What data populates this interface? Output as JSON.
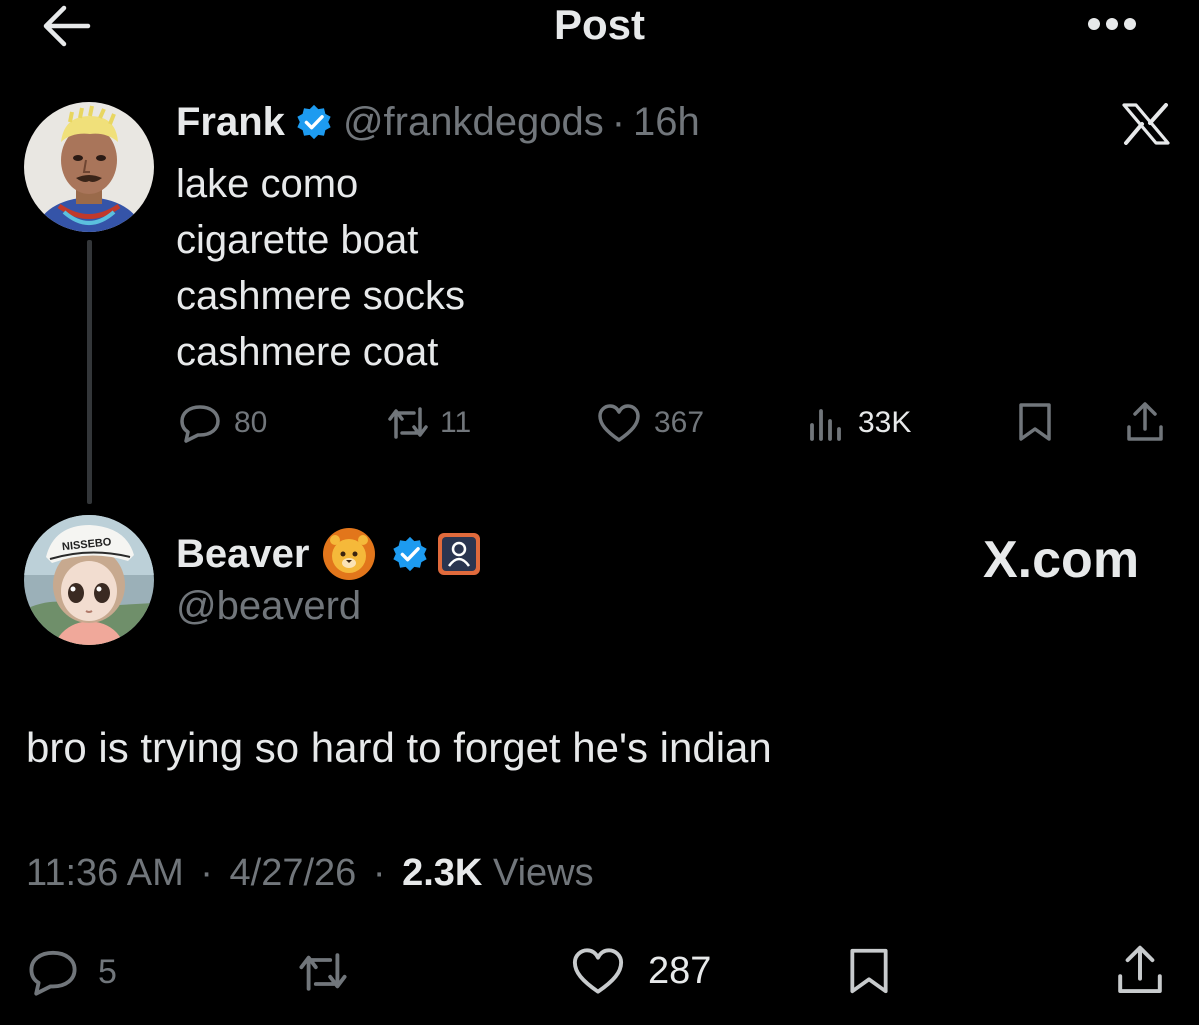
{
  "header": {
    "title": "Post",
    "back_icon": "arrow-left-icon",
    "more_icon": "more-horizontal-icon"
  },
  "parent_tweet": {
    "author_name": "Frank",
    "handle": "@frankdegods",
    "separator": "·",
    "time_ago": "16h",
    "text_lines": [
      "lake como",
      "cigarette boat",
      "cashmere socks",
      "cashmere coat"
    ],
    "replies": "80",
    "reposts": "11",
    "likes": "367",
    "views": "33K",
    "brand_icon": "x-logo-icon"
  },
  "reply_tweet": {
    "author_name": "Beaver",
    "handle": "@beaverd",
    "badge_text": "X.com",
    "text": "bro is trying so hard to forget he's indian",
    "time": "11:36 AM",
    "separator": "·",
    "date": "4/27/26",
    "views_count": "2.3K",
    "views_label": "Views",
    "replies": "5",
    "likes": "287"
  },
  "colors": {
    "background": "#000000",
    "text_primary": "#e7e9ea",
    "text_secondary": "#71767b",
    "verified_blue": "#1d9bf0",
    "thread_line": "#333639"
  }
}
